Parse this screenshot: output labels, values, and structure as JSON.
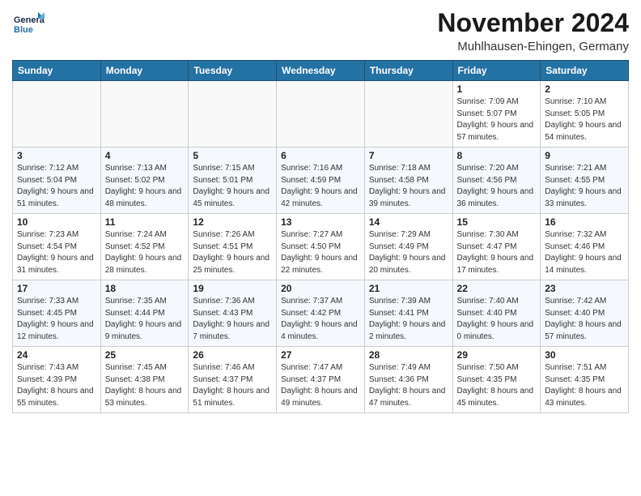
{
  "header": {
    "logo_text_general": "General",
    "logo_text_blue": "Blue",
    "month_title": "November 2024",
    "location": "Muhlhausen-Ehingen, Germany"
  },
  "days_of_week": [
    "Sunday",
    "Monday",
    "Tuesday",
    "Wednesday",
    "Thursday",
    "Friday",
    "Saturday"
  ],
  "weeks": [
    [
      {
        "day": "",
        "info": ""
      },
      {
        "day": "",
        "info": ""
      },
      {
        "day": "",
        "info": ""
      },
      {
        "day": "",
        "info": ""
      },
      {
        "day": "",
        "info": ""
      },
      {
        "day": "1",
        "info": "Sunrise: 7:09 AM\nSunset: 5:07 PM\nDaylight: 9 hours and 57 minutes."
      },
      {
        "day": "2",
        "info": "Sunrise: 7:10 AM\nSunset: 5:05 PM\nDaylight: 9 hours and 54 minutes."
      }
    ],
    [
      {
        "day": "3",
        "info": "Sunrise: 7:12 AM\nSunset: 5:04 PM\nDaylight: 9 hours and 51 minutes."
      },
      {
        "day": "4",
        "info": "Sunrise: 7:13 AM\nSunset: 5:02 PM\nDaylight: 9 hours and 48 minutes."
      },
      {
        "day": "5",
        "info": "Sunrise: 7:15 AM\nSunset: 5:01 PM\nDaylight: 9 hours and 45 minutes."
      },
      {
        "day": "6",
        "info": "Sunrise: 7:16 AM\nSunset: 4:59 PM\nDaylight: 9 hours and 42 minutes."
      },
      {
        "day": "7",
        "info": "Sunrise: 7:18 AM\nSunset: 4:58 PM\nDaylight: 9 hours and 39 minutes."
      },
      {
        "day": "8",
        "info": "Sunrise: 7:20 AM\nSunset: 4:56 PM\nDaylight: 9 hours and 36 minutes."
      },
      {
        "day": "9",
        "info": "Sunrise: 7:21 AM\nSunset: 4:55 PM\nDaylight: 9 hours and 33 minutes."
      }
    ],
    [
      {
        "day": "10",
        "info": "Sunrise: 7:23 AM\nSunset: 4:54 PM\nDaylight: 9 hours and 31 minutes."
      },
      {
        "day": "11",
        "info": "Sunrise: 7:24 AM\nSunset: 4:52 PM\nDaylight: 9 hours and 28 minutes."
      },
      {
        "day": "12",
        "info": "Sunrise: 7:26 AM\nSunset: 4:51 PM\nDaylight: 9 hours and 25 minutes."
      },
      {
        "day": "13",
        "info": "Sunrise: 7:27 AM\nSunset: 4:50 PM\nDaylight: 9 hours and 22 minutes."
      },
      {
        "day": "14",
        "info": "Sunrise: 7:29 AM\nSunset: 4:49 PM\nDaylight: 9 hours and 20 minutes."
      },
      {
        "day": "15",
        "info": "Sunrise: 7:30 AM\nSunset: 4:47 PM\nDaylight: 9 hours and 17 minutes."
      },
      {
        "day": "16",
        "info": "Sunrise: 7:32 AM\nSunset: 4:46 PM\nDaylight: 9 hours and 14 minutes."
      }
    ],
    [
      {
        "day": "17",
        "info": "Sunrise: 7:33 AM\nSunset: 4:45 PM\nDaylight: 9 hours and 12 minutes."
      },
      {
        "day": "18",
        "info": "Sunrise: 7:35 AM\nSunset: 4:44 PM\nDaylight: 9 hours and 9 minutes."
      },
      {
        "day": "19",
        "info": "Sunrise: 7:36 AM\nSunset: 4:43 PM\nDaylight: 9 hours and 7 minutes."
      },
      {
        "day": "20",
        "info": "Sunrise: 7:37 AM\nSunset: 4:42 PM\nDaylight: 9 hours and 4 minutes."
      },
      {
        "day": "21",
        "info": "Sunrise: 7:39 AM\nSunset: 4:41 PM\nDaylight: 9 hours and 2 minutes."
      },
      {
        "day": "22",
        "info": "Sunrise: 7:40 AM\nSunset: 4:40 PM\nDaylight: 9 hours and 0 minutes."
      },
      {
        "day": "23",
        "info": "Sunrise: 7:42 AM\nSunset: 4:40 PM\nDaylight: 8 hours and 57 minutes."
      }
    ],
    [
      {
        "day": "24",
        "info": "Sunrise: 7:43 AM\nSunset: 4:39 PM\nDaylight: 8 hours and 55 minutes."
      },
      {
        "day": "25",
        "info": "Sunrise: 7:45 AM\nSunset: 4:38 PM\nDaylight: 8 hours and 53 minutes."
      },
      {
        "day": "26",
        "info": "Sunrise: 7:46 AM\nSunset: 4:37 PM\nDaylight: 8 hours and 51 minutes."
      },
      {
        "day": "27",
        "info": "Sunrise: 7:47 AM\nSunset: 4:37 PM\nDaylight: 8 hours and 49 minutes."
      },
      {
        "day": "28",
        "info": "Sunrise: 7:49 AM\nSunset: 4:36 PM\nDaylight: 8 hours and 47 minutes."
      },
      {
        "day": "29",
        "info": "Sunrise: 7:50 AM\nSunset: 4:35 PM\nDaylight: 8 hours and 45 minutes."
      },
      {
        "day": "30",
        "info": "Sunrise: 7:51 AM\nSunset: 4:35 PM\nDaylight: 8 hours and 43 minutes."
      }
    ]
  ]
}
